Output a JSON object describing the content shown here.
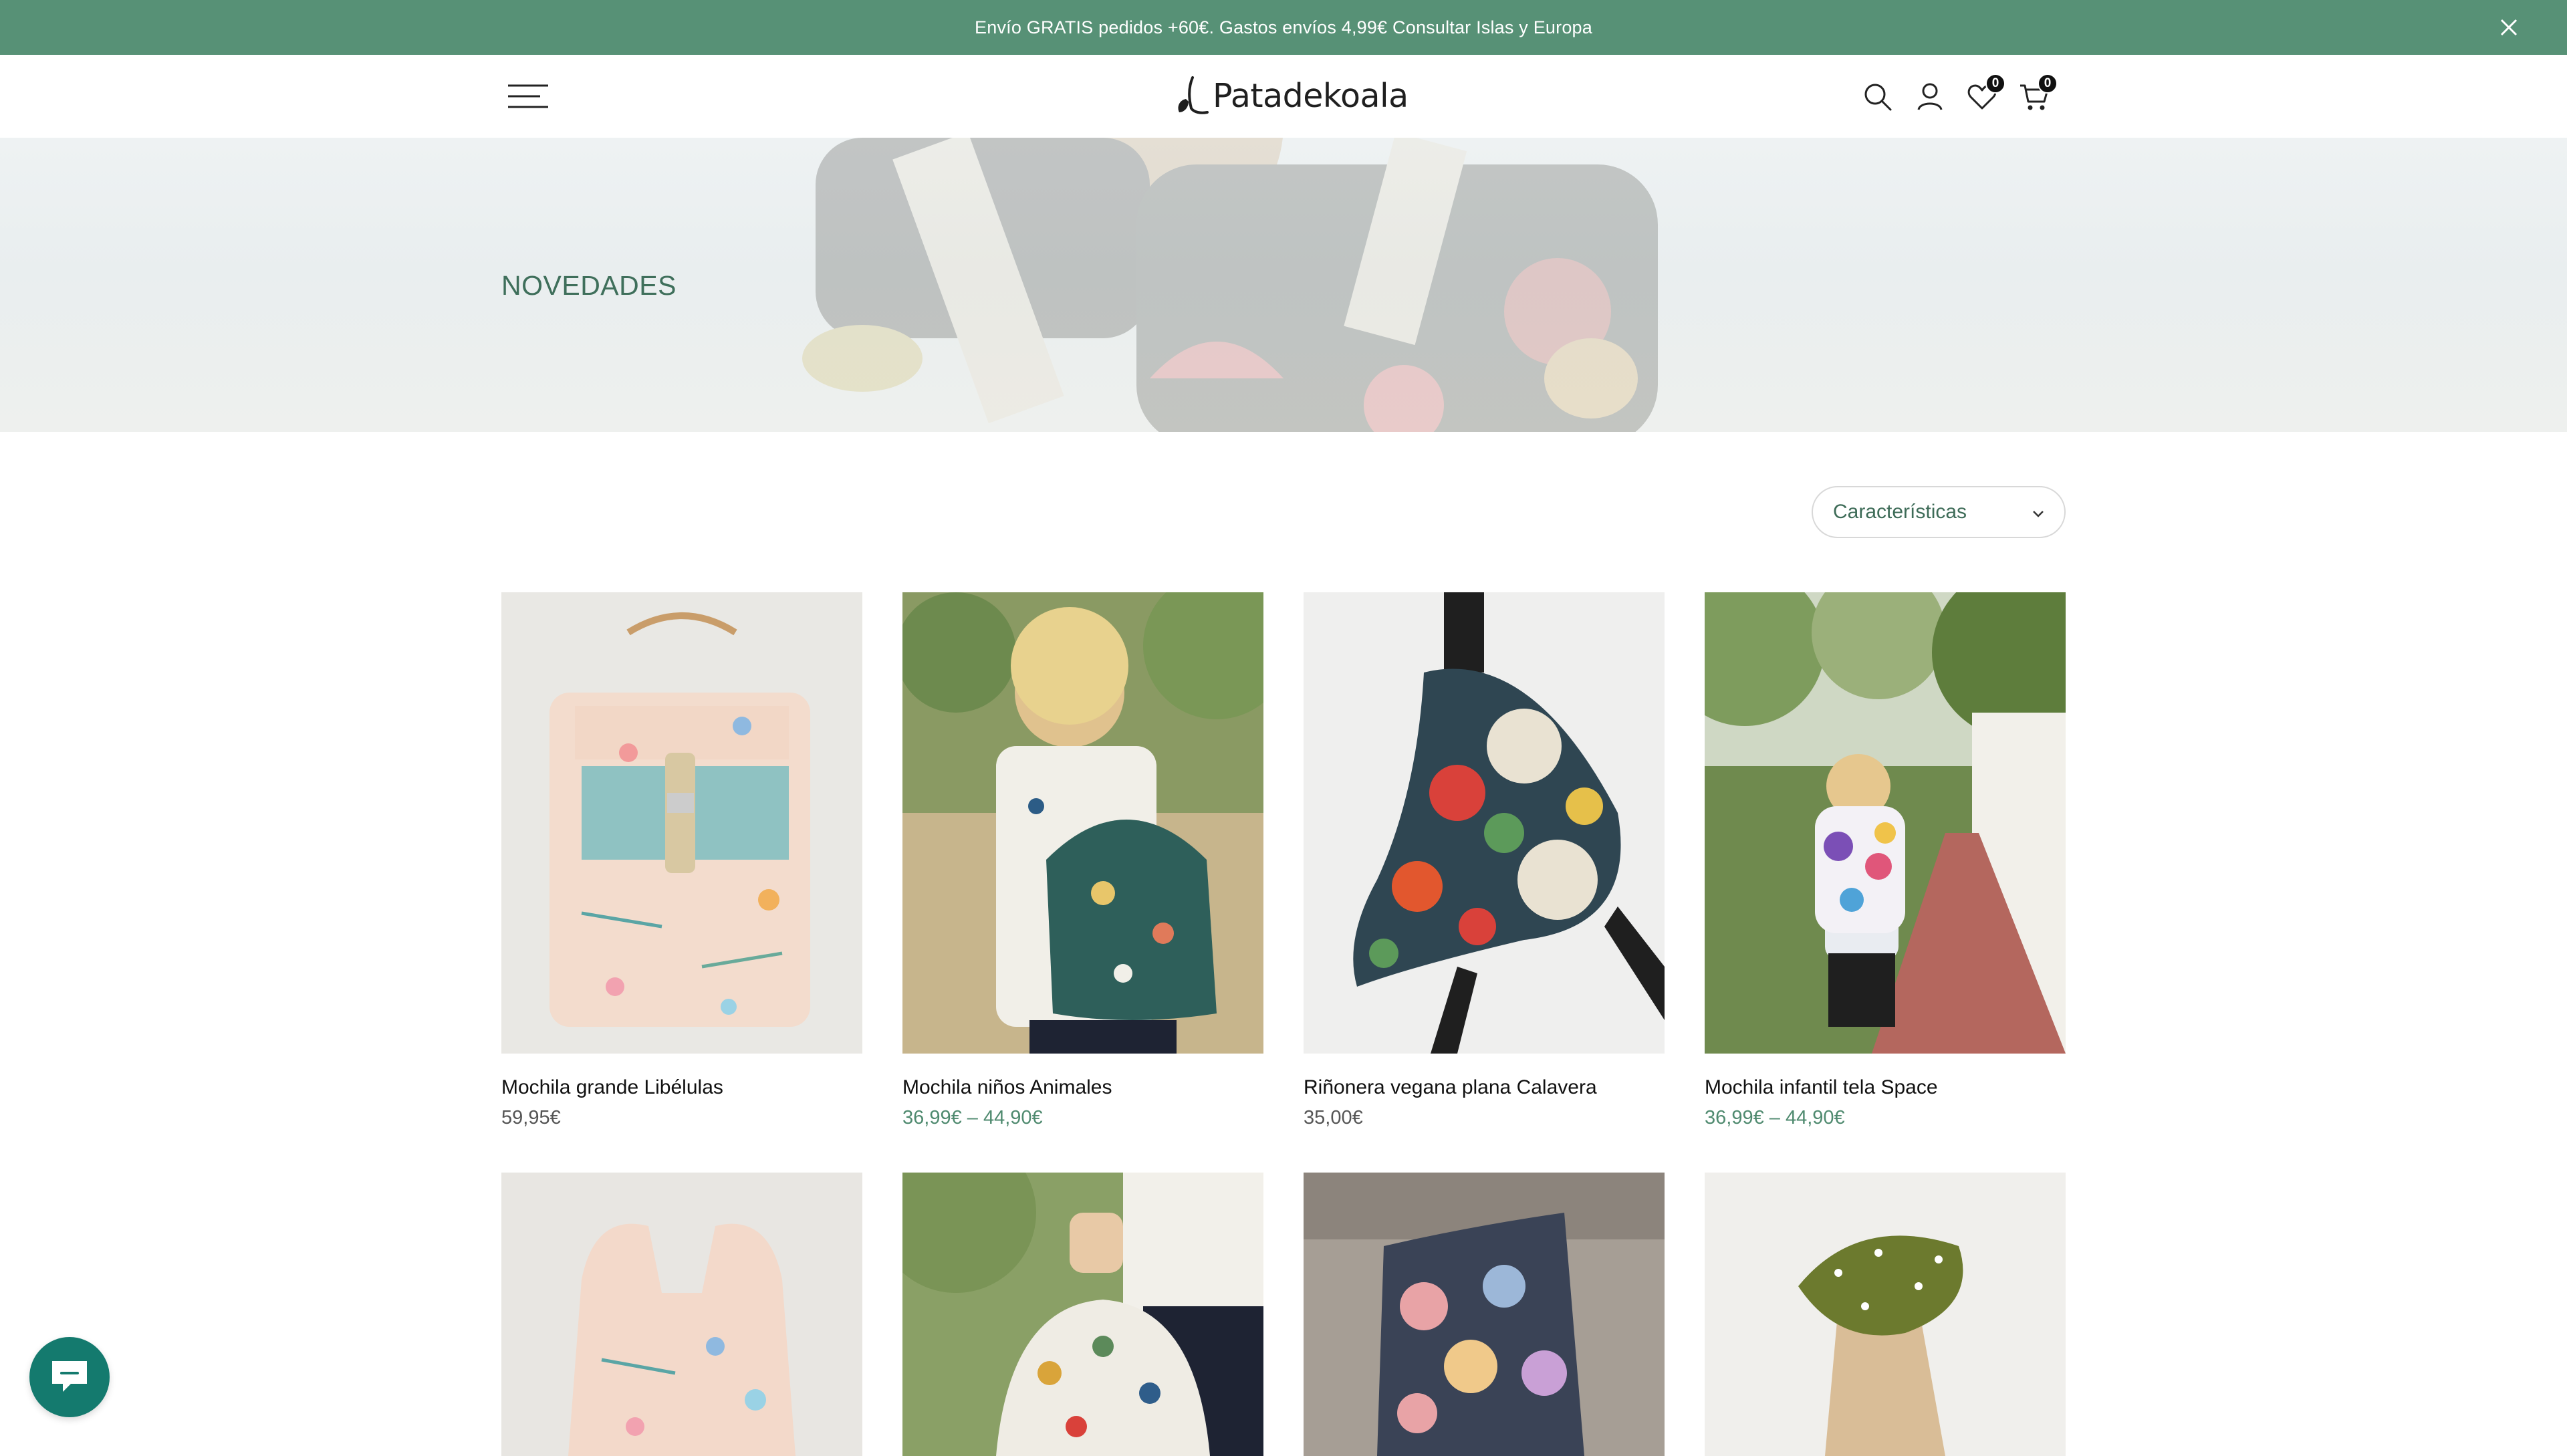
{
  "announcement": {
    "text": "Envío GRATIS pedidos +60€. Gastos envíos 4,99€ Consultar Islas y Europa",
    "background": "#579176"
  },
  "header": {
    "brand": "Patadekoala",
    "wishlist_count": "0",
    "cart_count": "0",
    "icons": [
      "menu-icon",
      "search-icon",
      "account-icon",
      "wishlist-heart-icon",
      "cart-icon"
    ]
  },
  "hero": {
    "title": "NOVEDADES"
  },
  "sort": {
    "label": "Características"
  },
  "products": [
    {
      "title": "Mochila grande Libélulas",
      "price": "59,95€"
    },
    {
      "title": "Mochila niños Animales",
      "price": "36,99€ – 44,90€"
    },
    {
      "title": "Riñonera vegana plana Calavera",
      "price": "35,00€"
    },
    {
      "title": "Mochila infantil tela Space",
      "price": "36,99€ – 44,90€"
    }
  ],
  "colors": {
    "accent": "#579176",
    "title_green": "#3f6f5b",
    "price_green": "#4f8a6f",
    "chat": "#147a6e"
  }
}
